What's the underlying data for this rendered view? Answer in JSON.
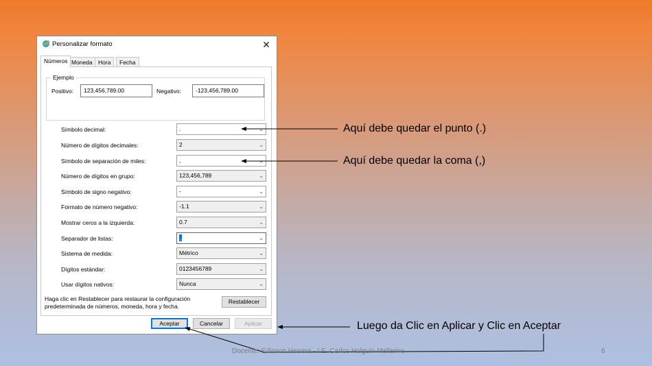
{
  "dialog": {
    "title": "Personalizar formato",
    "close_glyph": "✕",
    "tabs": [
      "Números",
      "Moneda",
      "Hora",
      "Fecha"
    ],
    "example": {
      "legend": "Ejemplo",
      "positive_label": "Positivo:",
      "positive_value": "123,456,789.00",
      "negative_label": "Negativo:",
      "negative_value": "-123,456,789.00"
    },
    "settings": [
      {
        "label": "Símbolo decimal:",
        "value": "."
      },
      {
        "label": "Número de dígitos decimales:",
        "value": "2"
      },
      {
        "label": "Símbolo de separación de miles:",
        "value": ","
      },
      {
        "label": "Número de dígitos en grupo:",
        "value": "123,456,789"
      },
      {
        "label": "Símbolo de signo negativo:",
        "value": "-"
      },
      {
        "label": "Formato de número negativo:",
        "value": "-1.1"
      },
      {
        "label": "Mostrar ceros a la izquierda:",
        "value": "0.7"
      },
      {
        "label": "Separador de listas:",
        "value": ","
      },
      {
        "label": "Sistema de medida:",
        "value": "Métrico"
      },
      {
        "label": "Dígitos estándar:",
        "value": "0123456789"
      },
      {
        "label": "Usar dígitos nativos:",
        "value": "Nunca"
      }
    ],
    "restore_text": "Haga clic en Restablecer para restaurar la configuración predeterminada de números, moneda, hora y fecha.",
    "restore_button": "Restablecer",
    "ok_button": "Aceptar",
    "cancel_button": "Cancelar",
    "apply_button": "Aplicar"
  },
  "annotations": {
    "decimal_note": "Aquí debe quedar el punto (.)",
    "thousands_note": "Aquí debe quedar la coma (,)",
    "apply_note": "Luego da Clic en Aplicar y Clic en Aceptar"
  },
  "footer": {
    "credit": "Docente: Edinson Herrera - I.E. Carlos Holguín Mallarino",
    "page_number": "6"
  },
  "icons": {
    "title_icon": "regional-settings-icon",
    "dropdown": "chevron-down-icon"
  }
}
